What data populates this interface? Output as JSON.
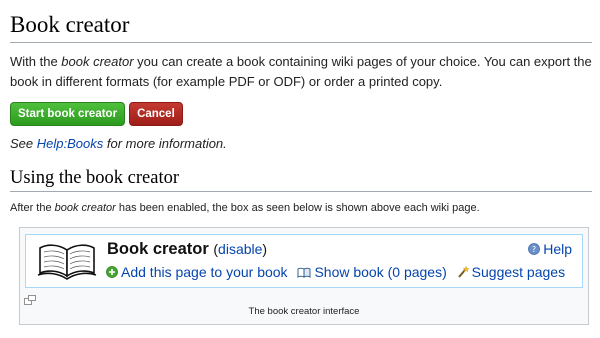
{
  "heading": "Book creator",
  "intro": {
    "before": "With the ",
    "italic": "book creator",
    "after": " you can create a book containing wiki pages of your choice. You can export the book in different formats (for example PDF or ODF) or order a printed copy."
  },
  "buttons": {
    "start": "Start book creator",
    "cancel": "Cancel"
  },
  "see": {
    "before": "See ",
    "link": "Help:Books",
    "after": " for more information."
  },
  "section": {
    "title": "Using the book creator",
    "text_before": "After the ",
    "text_italic": "book creator",
    "text_after": " has been enabled, the box as seen below is shown above each wiki page."
  },
  "figure": {
    "box_title": "Book creator",
    "open_paren": "(",
    "disable_link": "disable",
    "close_paren": ")",
    "help_link": "Help",
    "actions": {
      "add": "Add this page to your book",
      "show": "Show book (0 pages)",
      "suggest": "Suggest pages"
    },
    "caption": "The book creator interface"
  },
  "colors": {
    "link": "#0645ad",
    "start_button": "#36a829",
    "cancel_button": "#b12a23"
  }
}
